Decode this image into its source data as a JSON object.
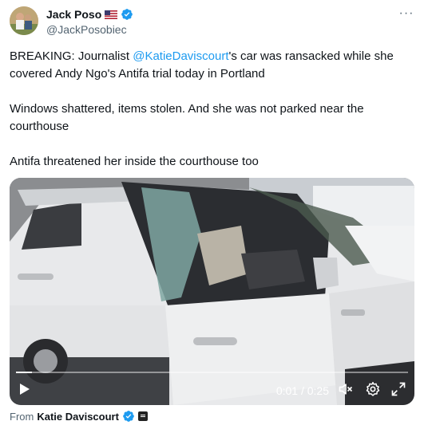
{
  "author": {
    "display_name": "Jack Poso",
    "handle": "@JackPosobiec",
    "flag_icon": "us-flag-icon",
    "verified_color": "#1d9bf0"
  },
  "tweet": {
    "text_before_mention": "BREAKING: Journalist ",
    "mention": "@KatieDaviscourt",
    "text_after_mention": "'s car was ransacked while she covered Andy Ngo's Antifa trial today in Portland\n\nWindows shattered, items stolen. And she was not parked near the courthouse\n\nAntifa threatened her inside the courthouse too"
  },
  "video": {
    "time": "0:01 / 0:25",
    "progress": 0.04
  },
  "attribution": {
    "prefix": "From",
    "name": "Katie Daviscourt"
  },
  "colors": {
    "accent": "#1d9bf0",
    "secondary_text": "#536471"
  }
}
